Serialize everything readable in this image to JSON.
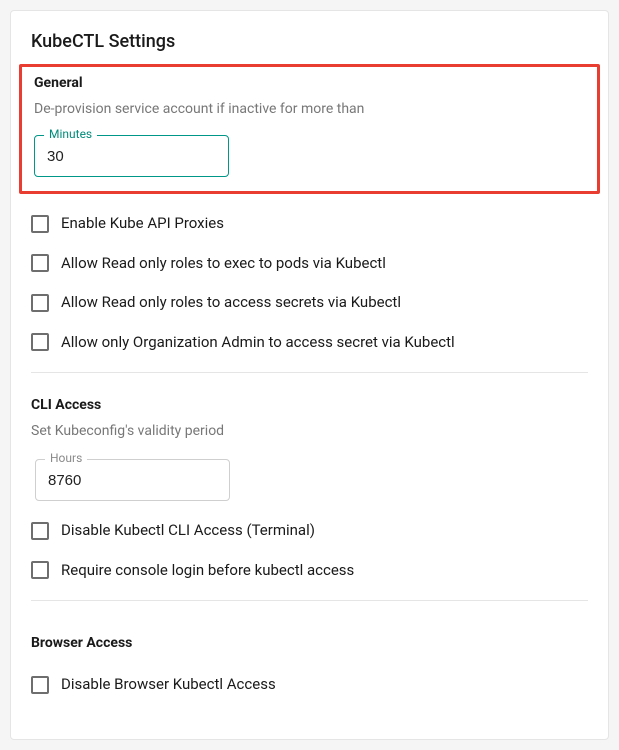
{
  "title": "KubeCTL Settings",
  "general": {
    "heading": "General",
    "sub_label": "De-provision service account if inactive for more than",
    "minutes_label": "Minutes",
    "minutes_value": "30",
    "checkboxes": [
      {
        "label": "Enable Kube API Proxies"
      },
      {
        "label": "Allow Read only roles to exec to pods via Kubectl"
      },
      {
        "label": "Allow Read only roles to access secrets via Kubectl"
      },
      {
        "label": "Allow only Organization Admin to access secret via Kubectl"
      }
    ]
  },
  "cli": {
    "heading": "CLI Access",
    "sub_label": "Set Kubeconfig's validity period",
    "hours_label": "Hours",
    "hours_value": "8760",
    "checkboxes": [
      {
        "label": "Disable Kubectl CLI Access (Terminal)"
      },
      {
        "label": "Require console login before kubectl access"
      }
    ]
  },
  "browser": {
    "heading": "Browser Access",
    "checkboxes": [
      {
        "label": "Disable Browser Kubectl Access"
      }
    ]
  }
}
